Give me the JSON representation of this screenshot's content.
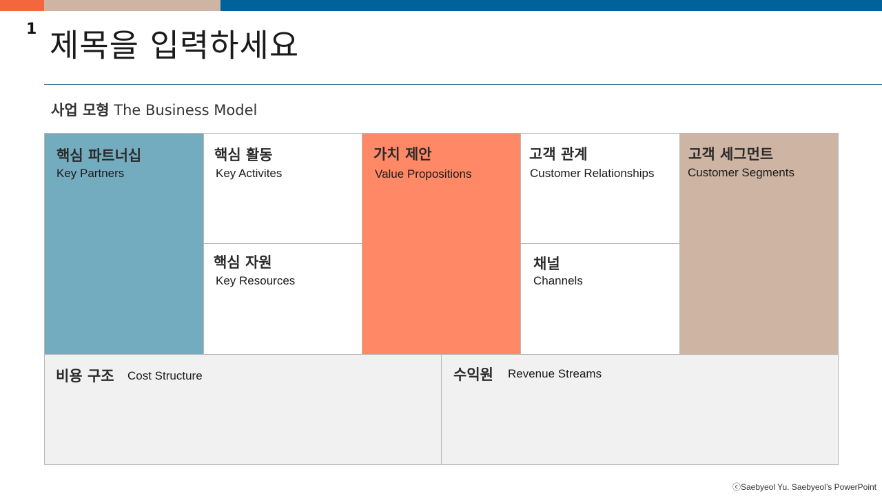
{
  "slide": {
    "number": "1",
    "title": "제목을 입력하세요"
  },
  "subtitle": {
    "korean": "사업 모형",
    "english": "The Business Model"
  },
  "canvas": {
    "key_partners": {
      "ko": "핵심 파트너십",
      "en": "Key Partners"
    },
    "key_activities": {
      "ko": "핵심 활동",
      "en": "Key Activites"
    },
    "key_resources": {
      "ko": "핵심 자원",
      "en": "Key Resources"
    },
    "value_propositions": {
      "ko": "가치 제안",
      "en": "Value Propositions"
    },
    "customer_relationships": {
      "ko": "고객 관계",
      "en": "Customer Relationships"
    },
    "channels": {
      "ko": "채널",
      "en": "Channels"
    },
    "customer_segments": {
      "ko": "고객 세그먼트",
      "en": "Customer Segments"
    },
    "cost_structure": {
      "ko": "비용 구조",
      "en": "Cost Structure"
    },
    "revenue_streams": {
      "ko": "수익원",
      "en": "Revenue Streams"
    }
  },
  "footer": {
    "credit": "ⓒSaebyeol Yu. Saebyeol’s PowerPoint"
  },
  "colors": {
    "accent_orange": "#f4663c",
    "accent_tan": "#cdb4a3",
    "accent_blue": "#00629b",
    "partners_blue": "#74acbf",
    "value_coral": "#ff8866",
    "bottom_gray": "#f1f1f1"
  }
}
